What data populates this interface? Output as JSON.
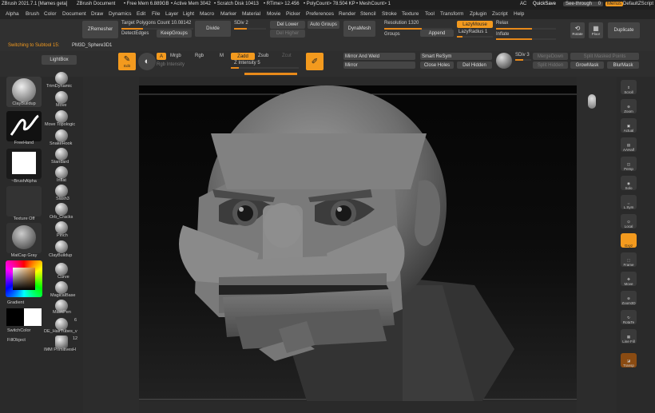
{
  "title": {
    "app": "ZBrush 2021.7.1 [Mames geta]",
    "doc": "ZBrush Document",
    "free_mem": "• Free Mem 6.889GB",
    "active_mem": "• Active Mem 3042",
    "scratch": "• Scratch Disk 10413",
    "rtime": "• RTime> 12.456",
    "polycount": "• PolyCount> 78.504 KP",
    "meshcount": "• MeshCount> 1",
    "ac": "AC",
    "quicksave": "QuickSave",
    "see_through": "See-through",
    "see_through_val": "0",
    "menus": "Menus",
    "default_script": "DefaultZScript"
  },
  "menu": [
    "Alpha",
    "Brush",
    "Color",
    "Document",
    "Draw",
    "Dynamics",
    "Edit",
    "File",
    "Layer",
    "Light",
    "Macro",
    "Marker",
    "Material",
    "Movie",
    "Picker",
    "Preferences",
    "Render",
    "Stencil",
    "Stroke",
    "Texture",
    "Tool",
    "Transform",
    "Zplugin",
    "Zscript",
    "Help"
  ],
  "topbar": {
    "zremesher": "ZRemesher",
    "target_poly": "Target Polygons Count 10.08142",
    "detect_edges": "DetectEdges",
    "keep_groups": "KeepGroups",
    "divide": "Divide",
    "sdiv": "SDiv 2",
    "del_lower": "Del Lower",
    "del_higher": "Del Higher",
    "auto_groups": "Auto Groups",
    "dynamesh": "DynaMesh",
    "resolution": "Resolution 1320",
    "groups": "Groups",
    "append": "Append",
    "lazymouse": "LazyMouse",
    "lazyradius": "LazyRadius 1",
    "relax": "Relax",
    "inflate": "Inflate",
    "rotate": "Rotate",
    "floor": "Floor",
    "duplicate": "Duplicate",
    "switching": "Switching to Subtool 15:",
    "subtool": "PM3D_Sphere3D1"
  },
  "toolbar": {
    "lightbox": "LightBox",
    "edit": "Edit",
    "a": "A",
    "mrgb": "Mrgb",
    "rgb": "Rgb",
    "m": "M",
    "zadd": "Zadd",
    "zsub": "Zsub",
    "zcut": "Zcut",
    "rgb_intensity": "Rgb Intensity",
    "z_intensity": "Z Intensity 5",
    "mirror_weld": "Mirror And Weld",
    "mirror": "Mirror",
    "smart_resym": "Smart ReSym",
    "close_holes": "Close Holes",
    "del_hidden": "Del Hidden",
    "sdiv3": "SDiv 3",
    "merge_down": "MergeDown",
    "split_hidden": "Split Hidden",
    "split_masked": "Split Masked Points",
    "grow_mask": "GrowMask",
    "blur_mask": "BlurMask"
  },
  "left": {
    "claybuildup": "ClayBuildup",
    "freehand": "FreeHand",
    "brush_alpha": "~BrushAlpha",
    "texture_off": "Texture Off",
    "matcap": "MatCap Gray",
    "gradient": "Gradient",
    "switch_color": "SwitchColor",
    "fill_object": "FillObject",
    "tools": [
      "TrimDynamic",
      "Move",
      "Move Topologic",
      "SnakeHook",
      "Standard",
      "Inflat",
      "Slash3",
      "Orb_Cracks",
      "Pinch",
      "ClayBuildup",
      "Curve",
      "MagicalBase",
      "MaskPen",
      "DE_HairTubes_v",
      "IMM PrimitivesH"
    ],
    "count6": "6",
    "count12": "12",
    "colors": {
      "primary": "#000000",
      "secondary": "#ffffff",
      "accent": "#f39a1e"
    }
  },
  "right": [
    "Scroll",
    "Zoom",
    "Actual",
    "AAHalf",
    "Persp",
    "Solo",
    "L.Sym",
    "Local",
    "Gxyz",
    "Frame",
    "Move",
    "Zoom3D",
    "RotaTe",
    "Line Fill",
    "Transp"
  ]
}
